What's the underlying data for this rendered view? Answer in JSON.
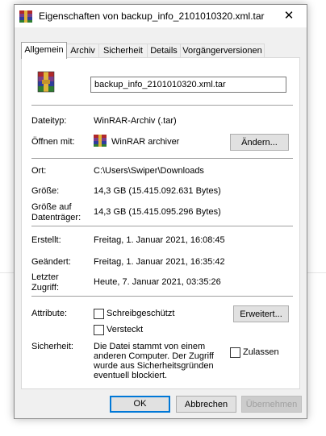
{
  "window": {
    "title": "Eigenschaften von backup_info_2101010320.xml.tar",
    "close_glyph": "✕",
    "icon": "winrar-archive-icon"
  },
  "tabs": [
    {
      "label": "Allgemein",
      "active": true
    },
    {
      "label": "Archiv",
      "active": false
    },
    {
      "label": "Sicherheit",
      "active": false
    },
    {
      "label": "Details",
      "active": false
    },
    {
      "label": "Vorgängerversionen",
      "active": false
    }
  ],
  "general": {
    "file_name": "backup_info_2101010320.xml.tar",
    "file_type_label": "Dateityp:",
    "file_type_value": "WinRAR-Archiv (.tar)",
    "open_with_label": "Öffnen mit:",
    "open_with_value": "WinRAR archiver",
    "change_button": "Ändern...",
    "location_label": "Ort:",
    "location_value": "C:\\Users\\Swiper\\Downloads",
    "size_label": "Größe:",
    "size_value": "14,3 GB (15.415.092.631 Bytes)",
    "size_on_disk_label_1": "Größe auf",
    "size_on_disk_label_2": "Datenträger:",
    "size_on_disk_value": "14,3 GB (15.415.095.296 Bytes)",
    "created_label": "Erstellt:",
    "created_value": "Freitag, 1. Januar 2021, 16:08:45",
    "modified_label": "Geändert:",
    "modified_value": "Freitag, 1. Januar 2021, 16:35:42",
    "accessed_label_1": "Letzter",
    "accessed_label_2": "Zugriff:",
    "accessed_value": "Heute, 7. Januar 2021, 03:35:26",
    "attributes_label": "Attribute:",
    "readonly_label": "Schreibgeschützt",
    "hidden_label": "Versteckt",
    "advanced_button": "Erweitert...",
    "security_label": "Sicherheit:",
    "security_text_1": "Die Datei stammt von einem",
    "security_text_2": "anderen Computer. Der Zugriff",
    "security_text_3": "wurde aus Sicherheitsgründen",
    "security_text_4": "eventuell blockiert.",
    "unblock_label": "Zulassen"
  },
  "footer": {
    "ok": "OK",
    "cancel": "Abbrechen",
    "apply": "Übernehmen"
  },
  "colors": {
    "accent": "#0078d7",
    "winrar_red": "#b0282a",
    "winrar_blue": "#2f3d9e",
    "winrar_gold": "#e0b43a",
    "winrar_purple": "#7a3e8a"
  }
}
